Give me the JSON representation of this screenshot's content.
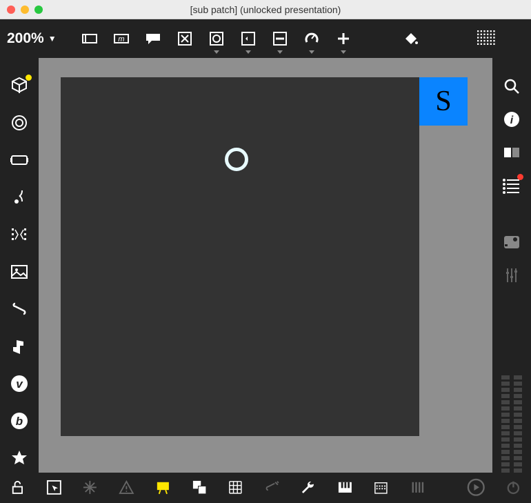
{
  "window": {
    "title": "[sub patch] (unlocked presentation)"
  },
  "zoom": {
    "label": "200%"
  },
  "snapshot": {
    "label": "S"
  },
  "top_tools": [
    {
      "name": "object-box",
      "dd": false
    },
    {
      "name": "message-box",
      "dd": false
    },
    {
      "name": "comment",
      "dd": false
    },
    {
      "name": "toggle",
      "dd": false
    },
    {
      "name": "button",
      "dd": true
    },
    {
      "name": "number-box",
      "dd": true
    },
    {
      "name": "slider",
      "dd": true
    },
    {
      "name": "dial",
      "dd": true
    },
    {
      "name": "add",
      "dd": true
    }
  ],
  "left_tools": [
    "basic-objects",
    "ui-objects",
    "jitter-objects",
    "audio-objects",
    "data-objects",
    "images",
    "files",
    "max-for-live",
    "vizzie",
    "beap",
    "favorites"
  ],
  "right_tools_top": [
    "search",
    "inspector",
    "format",
    "clue"
  ],
  "right_tools_mid": [
    "console",
    "reference",
    "parameters"
  ],
  "bottom_tools": [
    "lock",
    "select",
    "freeze",
    "debug",
    "presentation",
    "new-view",
    "grid",
    "snap",
    "wrench",
    "piano",
    "calendar",
    "meter",
    "audio-on",
    "power"
  ],
  "colors": {
    "accent": "#0a84ff",
    "panel": "#222222",
    "canvas": "#333333",
    "workspace": "#8f8f8f",
    "presentation_highlight": "#ffe600"
  }
}
